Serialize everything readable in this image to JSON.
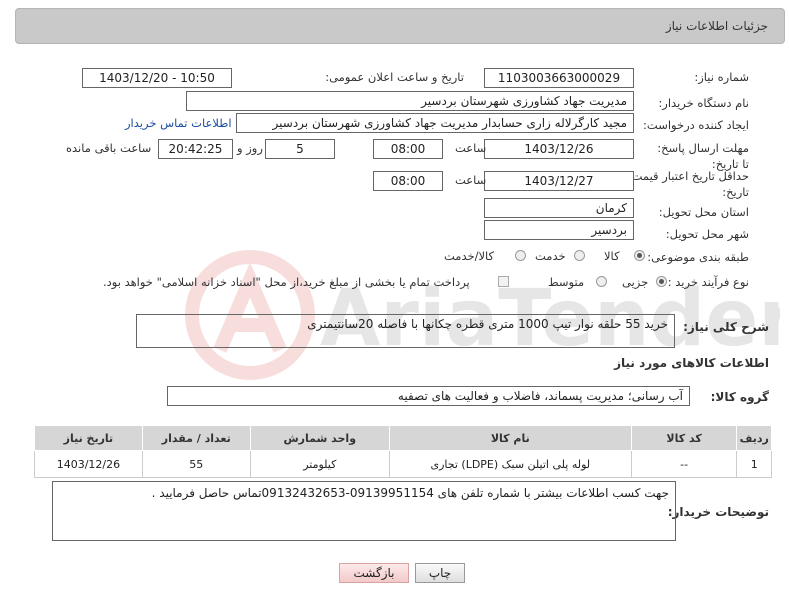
{
  "header": {
    "title": "جزئیات اطلاعات نیاز"
  },
  "fields": {
    "need_number_label": "شماره نیاز:",
    "need_number": "1103003663000029",
    "announce_label": "تاریخ و ساعت اعلان عمومی:",
    "announce_value": "1403/12/20 - 10:50",
    "buyer_org_label": "نام دستگاه خریدار:",
    "buyer_org": "مدیریت جهاد کشاورزی شهرستان بردسیر",
    "creator_label": "ایجاد کننده درخواست:",
    "creator": "مجید کارگرلاله زاری حسابدار مدیریت جهاد کشاورزی شهرستان بردسیر",
    "contact_link": "اطلاعات تماس خریدار",
    "deadline_label": "مهلت ارسال پاسخ: تا تاریخ:",
    "deadline_date": "1403/12/26",
    "time_label": "ساعت",
    "deadline_time": "08:00",
    "days_value": "5",
    "days_label": "روز و",
    "remaining_time": "20:42:25",
    "remaining_label": "ساعت باقی مانده",
    "validity_label": "حداقل تاریخ اعتبار قیمت: تا تاریخ:",
    "validity_date": "1403/12/27",
    "validity_time": "08:00",
    "province_label": "استان محل تحویل:",
    "province": "کرمان",
    "city_label": "شهر محل تحویل:",
    "city": "بردسیر",
    "category_label": "طبقه بندی موضوعی:",
    "category_options": [
      "کالا",
      "خدمت",
      "کالا/خدمت"
    ],
    "process_label": "نوع فرآیند خرید :",
    "process_options": [
      "جزیی",
      "متوسط"
    ],
    "payment_note": "پرداخت تمام یا بخشی از مبلغ خرید،از محل \"اسناد خزانه اسلامی\" خواهد بود."
  },
  "description": {
    "label": "شرح کلی نیاز:",
    "value": "خرید 55 حلقه نوار تیپ 1000 متری قطره چکانها  با فاصله 20سانتیمتری"
  },
  "goods_section": {
    "title": "اطلاعات کالاهای مورد نیاز",
    "group_label": "گروه کالا:",
    "group_value": "آب رسانی؛ مدیریت پسماند، فاضلاب و فعالیت های تصفیه"
  },
  "table": {
    "headers": [
      "ردیف",
      "کد کالا",
      "نام کالا",
      "واحد شمارش",
      "تعداد / مقدار",
      "تاریخ نیاز"
    ],
    "rows": [
      [
        "1",
        "--",
        "لوله پلی اتیلن سبک (LDPE) تجاری",
        "کیلومتر",
        "55",
        "1403/12/26"
      ]
    ]
  },
  "buyer_notes": {
    "label": "توضیحات خریدار:",
    "value": "جهت کسب اطلاعات بیشتر با شماره تلفن های 09139951154-09132432653تماس حاصل فرمایید ."
  },
  "buttons": {
    "print": "چاپ",
    "back": "بازگشت"
  },
  "watermark": {
    "text": "AriaTender.net"
  }
}
